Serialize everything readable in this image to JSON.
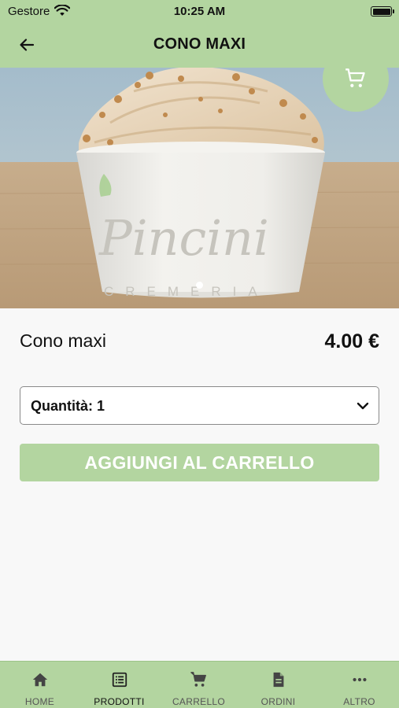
{
  "status_bar": {
    "carrier": "Gestore",
    "time": "10:25 AM"
  },
  "header": {
    "title": "CONO MAXI",
    "back_icon": "arrow-left-icon"
  },
  "hero": {
    "brand_text": "Pincini",
    "brand_subtext": "CREMERIA",
    "cart_icon": "cart-icon",
    "carousel_total": 1,
    "carousel_active": 1
  },
  "product": {
    "name": "Cono maxi",
    "price": "4.00 €"
  },
  "quantity": {
    "label": "Quantità: 1",
    "icon": "chevron-down-icon"
  },
  "add_to_cart": {
    "label": "AGGIUNGI AL CARRELLO"
  },
  "bottom_nav": {
    "items": [
      {
        "label": "HOME",
        "icon": "home-icon",
        "active": false
      },
      {
        "label": "PRODOTTI",
        "icon": "products-list-icon",
        "active": true
      },
      {
        "label": "CARRELLO",
        "icon": "cart-icon",
        "active": false
      },
      {
        "label": "ORDINI",
        "icon": "document-icon",
        "active": false
      },
      {
        "label": "ALTRO",
        "icon": "more-icon",
        "active": false
      }
    ]
  },
  "colors": {
    "accent": "#b3d5a0",
    "text": "#111111",
    "button_text": "#ffffff",
    "background": "#f8f8f8"
  }
}
